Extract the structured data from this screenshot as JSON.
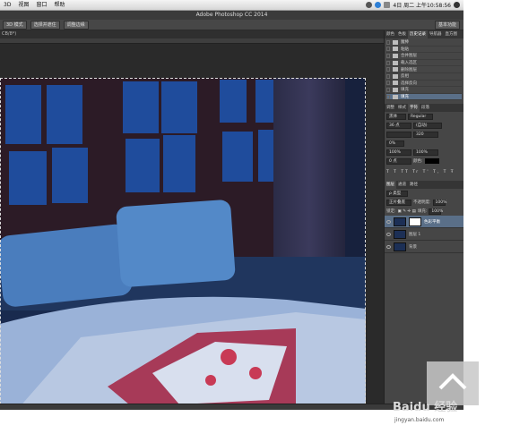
{
  "menu": {
    "items": [
      "3D",
      "视图",
      "窗口",
      "帮助"
    ],
    "clock": "4日 周二 上午10:58:56"
  },
  "title": "Adobe Photoshop CC 2014",
  "options": {
    "b1": "3D 模式",
    "b2": "选择并遮住",
    "b3": "调整边缘",
    "workspace": "基本功能"
  },
  "doc_tab": "CB/8*)",
  "panel": {
    "tabs": [
      "颜色",
      "色板",
      "历史记录",
      "导航器",
      "直方图"
    ],
    "history": [
      "魔棒",
      "粘贴",
      "合并图层",
      "载入选区",
      "删除图层",
      "反相",
      "选择反向",
      "填充",
      "填充"
    ],
    "char_tabs": [
      "调整",
      "样式",
      "字符",
      "段落"
    ],
    "font": "黑体",
    "font_style": "Regular",
    "size": "36 点",
    "leading": "(自动)",
    "kerning": "",
    "tracking": "320",
    "vscale": "0%",
    "h1": "100%",
    "h2": "100%",
    "baseline": "0 点",
    "color_label": "颜色:",
    "layer_tabs": [
      "图层",
      "通道",
      "路径"
    ],
    "kind": "ρ 类型",
    "blend": "正片叠底",
    "opacity_label": "不透明度:",
    "opacity": "100%",
    "lock_label": "锁定:",
    "fill_label": "填充:",
    "fill": "100%",
    "layers": [
      {
        "name": "色彩平衡",
        "sel": true
      },
      {
        "name": "图层 1",
        "sel": false
      },
      {
        "name": "背景",
        "sel": false
      }
    ]
  },
  "watermark": {
    "text": "Baidu 经验",
    "url": "jingyan.baidu.com"
  }
}
